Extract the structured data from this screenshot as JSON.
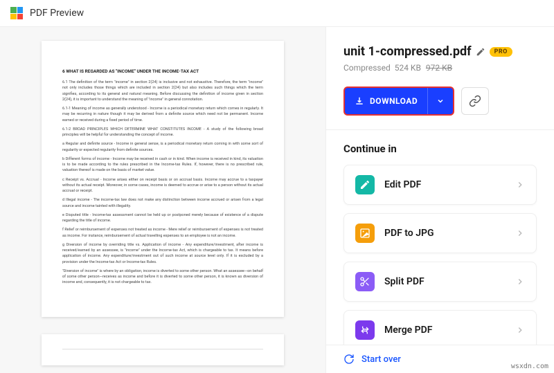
{
  "header": {
    "title": "PDF Preview"
  },
  "file": {
    "name": "unit 1-compressed.pdf",
    "pro_label": "PRO",
    "status": "Compressed",
    "new_size": "524 KB",
    "old_size": "972 KB"
  },
  "download": {
    "label": "DOWNLOAD"
  },
  "continue": {
    "title": "Continue in",
    "tools": [
      {
        "label": "Edit PDF",
        "icon": "edit",
        "color": "teal"
      },
      {
        "label": "PDF to JPG",
        "icon": "image",
        "color": "yellow"
      },
      {
        "label": "Split PDF",
        "icon": "scissors",
        "color": "purple"
      },
      {
        "label": "Merge PDF",
        "icon": "merge",
        "color": "purple2"
      }
    ]
  },
  "start_over": "Start over",
  "footer_url": "wsxdn.com",
  "doc": {
    "heading": "6 WHAT IS REGARDED AS \"INCOME\" UNDER THE INCOME-TAX ACT",
    "paras": [
      "6.1 The definition of the term \"income\" in section 2(24) is inclusive and not exhaustive. Therefore, the term \"income\" not only includes those things which are included in section 2(24) but also includes such things which the term signifies, according to its general and natural meaning. Before discussing the definition of income given in section 2(24), it is important to understand the meaning of \"income\" in general connotation.",
      "6.1-1 Meaning of income as generally understood - Income is a periodical monetary return which comes in regularly. It may be recurring in nature though it may be derived from a definite source which need not be permanent. Income earned or received during a fixed period of time.",
      "6.1-2 BROAD PRINCIPLES WHICH DETERMINE WHAT CONSTITUTES INCOME - A study of the following broad principles will be helpful for understanding the concept of income.",
      "a Regular and definite source - Income in general sense, is a periodical monetary return coming in with some sort of regularity or expected regularity from definite sources.",
      "b Different forms of income - Income may be received in cash or in kind. When income is received in kind, its valuation is to be made according to the rules prescribed in the Income-tax Rules. If, however, there is no prescribed rule, valuation thereof is made on the basis of market value.",
      "c Receipt vs. Accrual - Income arises either on receipt basis or on accrual basis. Income may accrue to a taxpayer without its actual receipt. Moreover, in some cases, income is deemed to accrue or arise to a person without its actual accrual or receipt.",
      "d Illegal income - The income-tax law does not make any distinction between income accrued or arisen from a legal source and income tainted with illegality.",
      "e Disputed title - Income-tax assessment cannot be held up or postponed merely because of existence of a dispute regarding the title of income.",
      "f Relief or reimbursement of expenses not treated as income - Mere relief or reimbursement of expenses is not treated as income. For instance, reimbursement of actual travelling expenses to an employee is not an income.",
      "g Diversion of income by overriding title vs. Application of income - Any expenditure/investment, after income is received/earned by an assessee, is \"income\" under the Income-tax Act, which is chargeable to tax. It means before application of income. Any expenditure/investment out of such income at source level only. If it is excluded by a provision under the Income-tax Act or Income-tax Rules.",
      "\"Diversion of income\" is where by an obligation, income is diverted to some other person. What an assessee—on behalf of some other person—receives as income and before it is diverted to some other person, it is known as diversion of income and, consequently, it is not chargeable to tax."
    ]
  }
}
